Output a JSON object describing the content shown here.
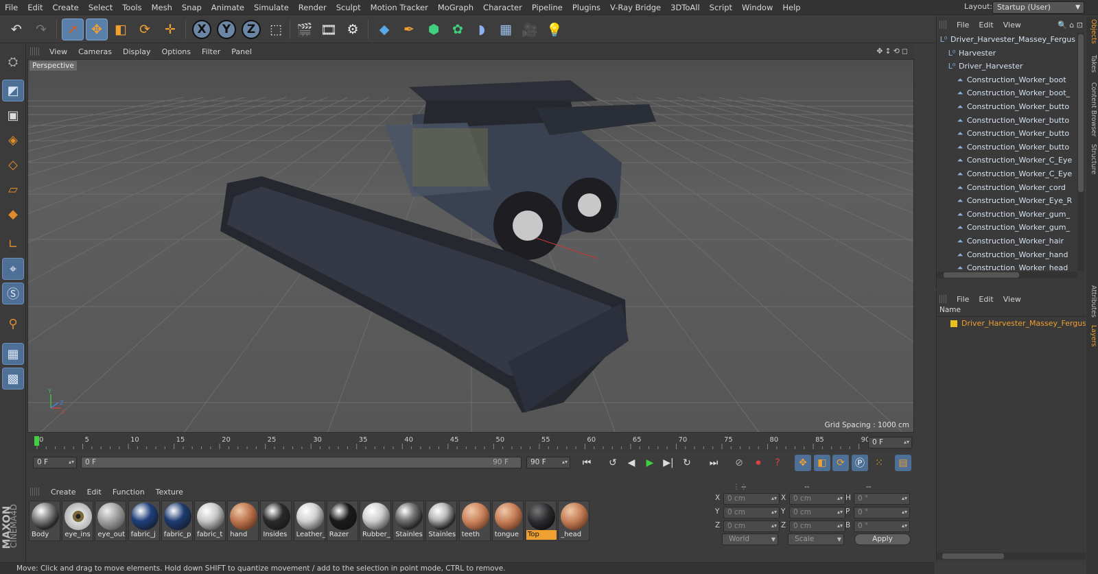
{
  "menubar": [
    "File",
    "Edit",
    "Create",
    "Select",
    "Tools",
    "Mesh",
    "Snap",
    "Animate",
    "Simulate",
    "Render",
    "Sculpt",
    "Motion Tracker",
    "MoGraph",
    "Character",
    "Pipeline",
    "Plugins",
    "V-Ray Bridge",
    "3DToAll",
    "Script",
    "Window",
    "Help"
  ],
  "layout": {
    "label": "Layout:",
    "value": "Startup (User)"
  },
  "toolbar": {
    "axis_x": "X",
    "axis_y": "Y",
    "axis_z": "Z",
    "icons": [
      "undo-icon",
      "redo-icon",
      "select-cursor-icon",
      "move-icon",
      "scale-icon",
      "rotate-icon",
      "recent-tool-icon",
      "coordinate-system-icon",
      "render-region-icon",
      "render-view-icon",
      "render-settings-icon",
      "cube-icon",
      "pen-icon",
      "subdivision-icon",
      "cloner-icon",
      "deformer-icon",
      "floor-icon",
      "camera-icon",
      "light-icon"
    ]
  },
  "viewport": {
    "menus": [
      "View",
      "Cameras",
      "Display",
      "Options",
      "Filter",
      "Panel"
    ],
    "label": "Perspective",
    "grid_spacing": "Grid Spacing : 1000 cm",
    "axis_labels": {
      "y": "Y",
      "z": "Z",
      "x": "X"
    }
  },
  "timeline": {
    "ticks": [
      "0",
      "5",
      "10",
      "15",
      "20",
      "25",
      "30",
      "35",
      "40",
      "45",
      "50",
      "55",
      "60",
      "65",
      "70",
      "75",
      "80",
      "85",
      "90"
    ],
    "current_frame": "0 F",
    "start_field": "0 F",
    "range_start": "0 F",
    "range_end": "90 F",
    "end_field": "90 F"
  },
  "material_manager": {
    "menus": [
      "Create",
      "Edit",
      "Function",
      "Texture"
    ],
    "materials": [
      {
        "name": "Body",
        "color": "#8a8a8a",
        "style": "chrome"
      },
      {
        "name": "eye_ins",
        "color": "#8a7a5a",
        "style": "eye"
      },
      {
        "name": "eye_out",
        "color": "#9a9a9a",
        "style": "glass"
      },
      {
        "name": "fabric_j",
        "color": "#1f3f7a",
        "style": "solid"
      },
      {
        "name": "fabric_p",
        "color": "#1e3c72",
        "style": "solid"
      },
      {
        "name": "fabric_t",
        "color": "#c8c8c8",
        "style": "solid"
      },
      {
        "name": "hand",
        "color": "#b8704a",
        "style": "skin"
      },
      {
        "name": "Insides",
        "color": "#2a2a2a",
        "style": "solid"
      },
      {
        "name": "Leather_",
        "color": "#d0d0d0",
        "style": "solid"
      },
      {
        "name": "Razer",
        "color": "#1a1a1a",
        "style": "solid"
      },
      {
        "name": "Rubber_",
        "color": "#cfcfcf",
        "style": "solid"
      },
      {
        "name": "Stainles",
        "color": "#7a7a7a",
        "style": "chrome"
      },
      {
        "name": "Stainles",
        "color": "#b8b8b8",
        "style": "chrome"
      },
      {
        "name": "teeth",
        "color": "#c9805a",
        "style": "skin"
      },
      {
        "name": "tongue",
        "color": "#c47a55",
        "style": "skin"
      },
      {
        "name": "Top",
        "color": "#2a2a2e",
        "style": "dark",
        "selected": true
      },
      {
        "name": "_head",
        "color": "#c17a52",
        "style": "skin"
      }
    ]
  },
  "coordinates": {
    "header": [
      "--",
      "--",
      "--"
    ],
    "rows": [
      {
        "l1": "X",
        "v1": "0 cm",
        "l2": "X",
        "v2": "0 cm",
        "l3": "H",
        "v3": "0 °"
      },
      {
        "l1": "Y",
        "v1": "0 cm",
        "l2": "Y",
        "v2": "0 cm",
        "l3": "P",
        "v3": "0 °"
      },
      {
        "l1": "Z",
        "v1": "0 cm",
        "l2": "Z",
        "v2": "0 cm",
        "l3": "B",
        "v3": "0 °"
      }
    ],
    "mode": "World",
    "size_mode": "Scale",
    "apply": "Apply"
  },
  "brand": {
    "line1": "MAXON",
    "line2": "CINEMA4D"
  },
  "status": "Move: Click and drag to move elements. Hold down SHIFT to quantize movement / add to the selection in point mode, CTRL to remove.",
  "object_manager": {
    "menus": [
      "File",
      "Edit",
      "View"
    ],
    "items": [
      {
        "name": "Driver_Harvester_Massey_Fergus",
        "level": 0,
        "type": "null"
      },
      {
        "name": "Harvester",
        "level": 1,
        "type": "null"
      },
      {
        "name": "Driver_Harvester",
        "level": 1,
        "type": "null"
      },
      {
        "name": "Construction_Worker_boot",
        "level": 2,
        "type": "bone"
      },
      {
        "name": "Construction_Worker_boot_",
        "level": 2,
        "type": "bone"
      },
      {
        "name": "Construction_Worker_butto",
        "level": 2,
        "type": "bone"
      },
      {
        "name": "Construction_Worker_butto",
        "level": 2,
        "type": "bone"
      },
      {
        "name": "Construction_Worker_butto",
        "level": 2,
        "type": "bone"
      },
      {
        "name": "Construction_Worker_butto",
        "level": 2,
        "type": "bone"
      },
      {
        "name": "Construction_Worker_C_Eye",
        "level": 2,
        "type": "bone"
      },
      {
        "name": "Construction_Worker_C_Eye",
        "level": 2,
        "type": "bone"
      },
      {
        "name": "Construction_Worker_cord",
        "level": 2,
        "type": "bone"
      },
      {
        "name": "Construction_Worker_Eye_R",
        "level": 2,
        "type": "bone"
      },
      {
        "name": "Construction_Worker_gum_",
        "level": 2,
        "type": "bone"
      },
      {
        "name": "Construction_Worker_gum_",
        "level": 2,
        "type": "bone"
      },
      {
        "name": "Construction_Worker_hair",
        "level": 2,
        "type": "bone"
      },
      {
        "name": "Construction_Worker_hand",
        "level": 2,
        "type": "bone"
      },
      {
        "name": "Construction_Worker_head",
        "level": 2,
        "type": "bone"
      }
    ]
  },
  "layer_manager": {
    "menus": [
      "File",
      "Edit",
      "View"
    ],
    "column": "Name",
    "layers": [
      {
        "name": "Driver_Harvester_Massey_Ferguso",
        "color": "#e8c020"
      }
    ]
  },
  "side_tabs": [
    "Objects",
    "Takes",
    "Content Browser",
    "Structure",
    "Attributes",
    "Layers"
  ]
}
